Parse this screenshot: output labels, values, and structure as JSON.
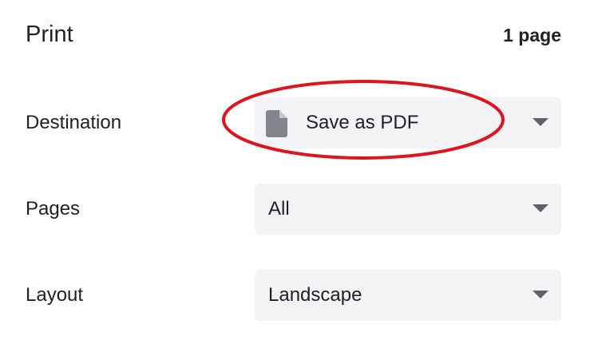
{
  "header": {
    "title": "Print",
    "page_count": "1 page"
  },
  "settings": {
    "destination": {
      "label": "Destination",
      "value": "Save as PDF",
      "icon": "file-icon"
    },
    "pages": {
      "label": "Pages",
      "value": "All"
    },
    "layout": {
      "label": "Layout",
      "value": "Landscape"
    }
  },
  "colors": {
    "select_background": "#f1f3f4",
    "text": "#202124",
    "icon": "#80868b",
    "caret": "#5f6368",
    "highlight_annotation": "#e0141e"
  }
}
